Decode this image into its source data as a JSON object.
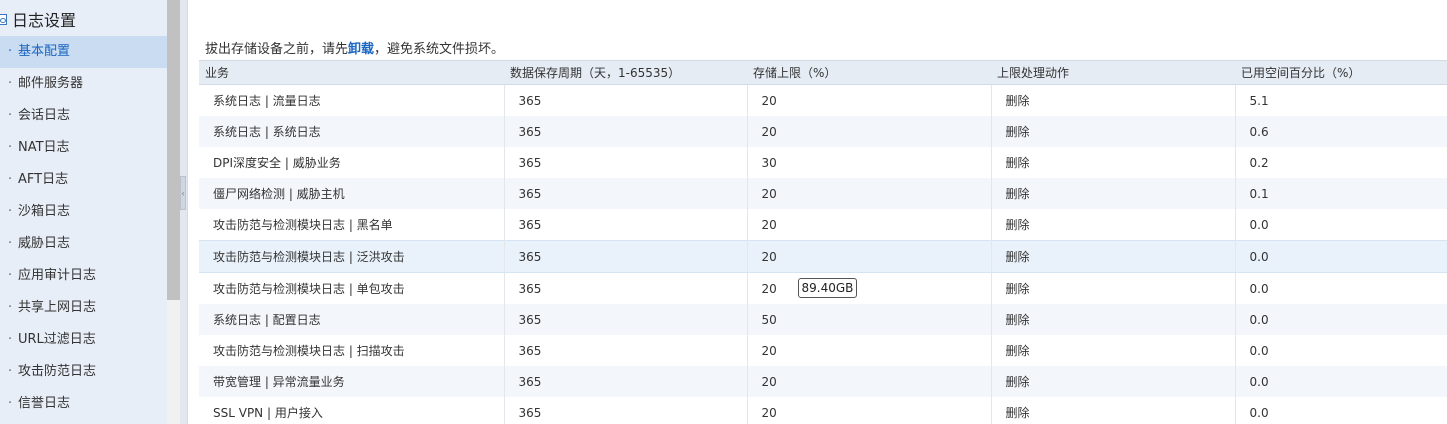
{
  "sidebar": {
    "section_title": "日志设置",
    "items": [
      {
        "label": "基本配置",
        "active": true
      },
      {
        "label": "邮件服务器"
      },
      {
        "label": "会话日志"
      },
      {
        "label": "NAT日志"
      },
      {
        "label": "AFT日志"
      },
      {
        "label": "沙箱日志"
      },
      {
        "label": "威胁日志"
      },
      {
        "label": "应用审计日志"
      },
      {
        "label": "共享上网日志"
      },
      {
        "label": "URL过滤日志"
      },
      {
        "label": "攻击防范日志"
      },
      {
        "label": "信誉日志"
      }
    ]
  },
  "notice": {
    "prefix": "拔出存储设备之前，请先",
    "link": "卸载",
    "suffix": "，避免系统文件损坏。"
  },
  "table": {
    "headers": [
      "业务",
      "数据保存周期（天，1-65535）",
      "存储上限（%）",
      "上限处理动作",
      "已用空间百分比（%）"
    ],
    "rows": [
      [
        "系统日志 | 流量日志",
        "365",
        "20",
        "删除",
        "5.1"
      ],
      [
        "系统日志 | 系统日志",
        "365",
        "20",
        "删除",
        "0.6"
      ],
      [
        "DPI深度安全 | 威胁业务",
        "365",
        "30",
        "删除",
        "0.2"
      ],
      [
        "僵尸网络检测 | 威胁主机",
        "365",
        "20",
        "删除",
        "0.1"
      ],
      [
        "攻击防范与检测模块日志 | 黑名单",
        "365",
        "20",
        "删除",
        "0.0"
      ],
      [
        "攻击防范与检测模块日志 | 泛洪攻击",
        "365",
        "20",
        "删除",
        "0.0"
      ],
      [
        "攻击防范与检测模块日志 | 单包攻击",
        "365",
        "20",
        "删除",
        "0.0"
      ],
      [
        "系统日志 | 配置日志",
        "365",
        "50",
        "删除",
        "0.0"
      ],
      [
        "攻击防范与检测模块日志 | 扫描攻击",
        "365",
        "20",
        "删除",
        "0.0"
      ],
      [
        "带宽管理 | 异常流量业务",
        "365",
        "20",
        "删除",
        "0.0"
      ],
      [
        "SSL VPN | 用户接入",
        "365",
        "20",
        "删除",
        "0.0"
      ]
    ],
    "hover_row": 5
  },
  "tooltip": {
    "text": "89.40GB",
    "row": 6
  },
  "colors": {
    "accent": "#1a66c2",
    "sidebar_bg": "#e8eef7",
    "active_bg": "#c9dcf2",
    "header_bg": "#e6ecf4"
  }
}
